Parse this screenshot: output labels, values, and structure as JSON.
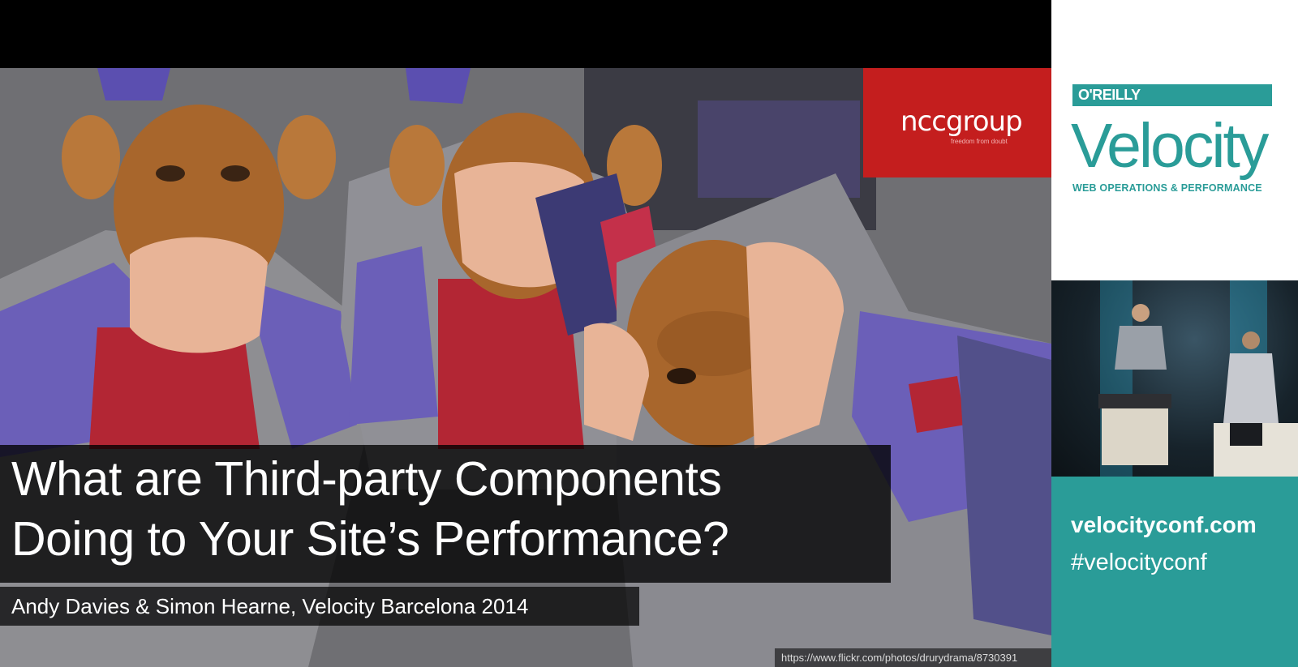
{
  "slide": {
    "title_line1": "What are Third-party Components",
    "title_line2": "Doing to Your Site’s Performance?",
    "byline": "Andy Davies & Simon Hearne, Velocity Barcelona 2014",
    "photo_credit": "https://www.flickr.com/photos/drurydrama/8730391",
    "sponsor": {
      "name": "nccgroup",
      "tagline": "freedom from doubt",
      "color": "#c41e1e"
    }
  },
  "sidebar": {
    "publisher": "O'REILLY",
    "brand": "Velocity",
    "tagline": "WEB OPERATIONS & PERFORMANCE",
    "site": "velocityconf.com",
    "hashtag": "#velocityconf",
    "accent_color": "#2a9c98"
  }
}
